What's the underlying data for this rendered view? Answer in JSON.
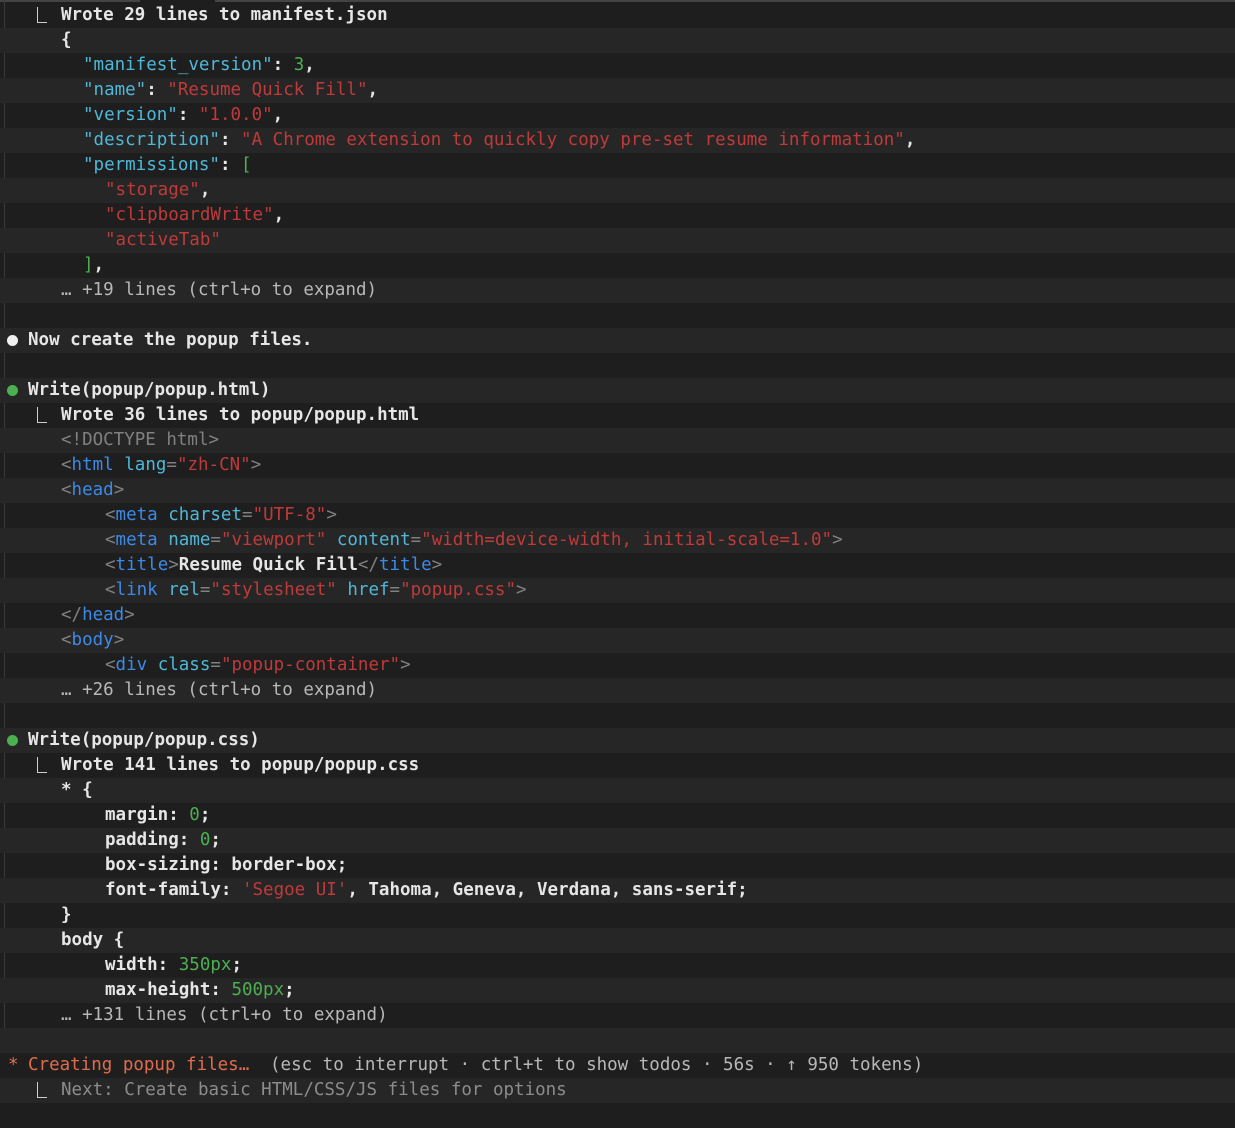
{
  "manifest_block": {
    "result": "Wrote 29 lines to manifest.json",
    "lines": [
      "{",
      "  \"manifest_version\": 3,",
      "  \"name\": \"Resume Quick Fill\",",
      "  \"version\": \"1.0.0\",",
      "  \"description\": \"A Chrome extension to quickly copy pre-set resume information\",",
      "  \"permissions\": [",
      "    \"storage\",",
      "    \"clipboardWrite\",",
      "    \"activeTab\"",
      "  ],"
    ],
    "collapsed": "… +19 lines (ctrl+o to expand)"
  },
  "message": "Now create the popup files.",
  "html_block": {
    "tool": "Write",
    "arg": "popup/popup.html",
    "result": "Wrote 36 lines to popup/popup.html",
    "lines": [
      "<!DOCTYPE html>",
      "<html lang=\"zh-CN\">",
      "<head>",
      "    <meta charset=\"UTF-8\">",
      "    <meta name=\"viewport\" content=\"width=device-width, initial-scale=1.0\">",
      "    <title>Resume Quick Fill</title>",
      "    <link rel=\"stylesheet\" href=\"popup.css\">",
      "</head>",
      "<body>",
      "    <div class=\"popup-container\">"
    ],
    "collapsed": "… +26 lines (ctrl+o to expand)"
  },
  "css_block": {
    "tool": "Write",
    "arg": "popup/popup.css",
    "result": "Wrote 141 lines to popup/popup.css",
    "lines": [
      "* {",
      "    margin: 0;",
      "    padding: 0;",
      "    box-sizing: border-box;",
      "    font-family: 'Segoe UI', Tahoma, Geneva, Verdana, sans-serif;",
      "}",
      "body {",
      "    width: 350px;",
      "    max-height: 500px;"
    ],
    "collapsed": "… +131 lines (ctrl+o to expand)"
  },
  "status": {
    "spinner": "*",
    "label": "Creating popup files…",
    "details": "(esc to interrupt · ctrl+t to show todos · 56s · ↑ 950 tokens)",
    "next": "Next: Create basic HTML/CSS/JS files for options"
  },
  "colors": {
    "background": "#1e1e1e",
    "stripe": "#262626",
    "string": "#c03a3a",
    "key": "#4fb8d8",
    "tag_name": "#3c8ae8",
    "number": "#4caf50",
    "status_orange": "#e06c4c",
    "bullet_green": "#4caf50",
    "bullet_white": "#f0f0f0"
  }
}
